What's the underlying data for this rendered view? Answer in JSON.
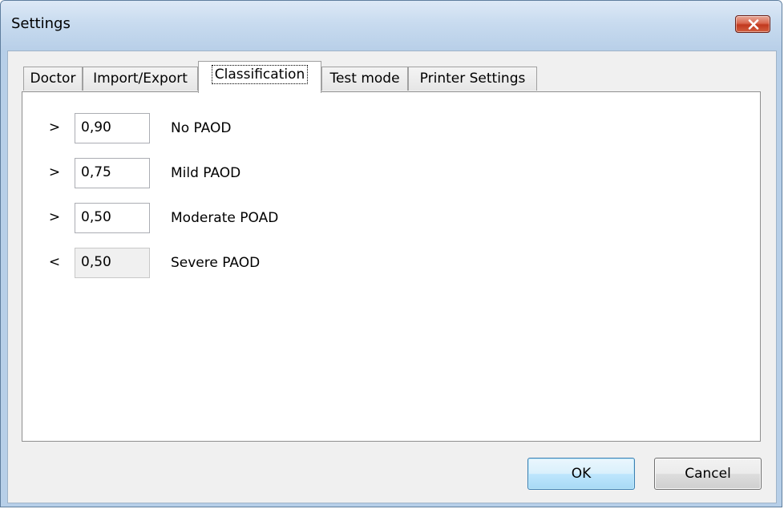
{
  "window": {
    "title": "Settings"
  },
  "tabs": [
    {
      "label": "Doctor",
      "active": false
    },
    {
      "label": "Import/Export",
      "active": false
    },
    {
      "label": "Classification",
      "active": true
    },
    {
      "label": "Test mode",
      "active": false
    },
    {
      "label": "Printer Settings",
      "active": false
    }
  ],
  "classification": {
    "rows": [
      {
        "operator": ">",
        "value": "0,90",
        "label": "No PAOD",
        "editable": true
      },
      {
        "operator": ">",
        "value": "0,75",
        "label": "Mild PAOD",
        "editable": true
      },
      {
        "operator": ">",
        "value": "0,50",
        "label": "Moderate POAD",
        "editable": true
      },
      {
        "operator": "<",
        "value": "0,50",
        "label": "Severe PAOD",
        "editable": false
      }
    ]
  },
  "buttons": {
    "ok": "OK",
    "cancel": "Cancel"
  },
  "icons": {
    "close": "close-icon"
  },
  "colors": {
    "close_button": "#c1391f",
    "ok_button_border": "#3c7fb1",
    "titlebar": "#c8dbef"
  }
}
